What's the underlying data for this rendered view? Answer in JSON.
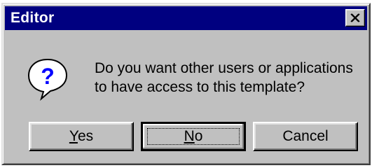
{
  "window": {
    "title": "Editor",
    "close_label": "X"
  },
  "message": {
    "line1": "Do you want other users or applications",
    "line2": "to have access to this template?"
  },
  "buttons": {
    "yes": {
      "mnemonic": "Y",
      "rest": "es"
    },
    "no": {
      "mnemonic": "N",
      "rest": "o"
    },
    "cancel": {
      "label": "Cancel"
    }
  },
  "icons": {
    "dialog_icon": "question-icon",
    "close": "close-icon"
  },
  "colors": {
    "titlebar": "#000080",
    "face": "#c0c0c0",
    "question_mark": "#0000ff"
  }
}
